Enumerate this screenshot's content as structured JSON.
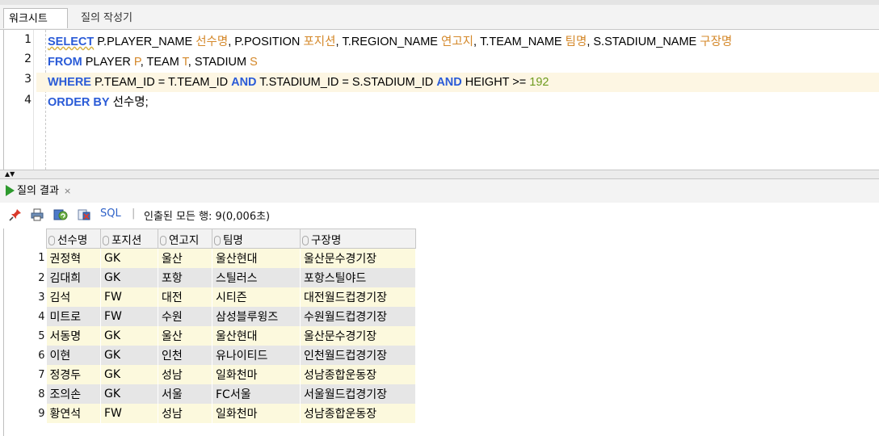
{
  "tabs": {
    "worksheet": "워크시트",
    "builder": "질의 작성기"
  },
  "sql": {
    "line_numbers": [
      "1",
      "2",
      "3",
      "4"
    ],
    "l1": {
      "select": "SELECT",
      "a": " P.PLAYER_NAME ",
      "a_alias": "선수명",
      "b": ", P.POSITION ",
      "b_alias": "포지션",
      "c": ", T.REGION_NAME ",
      "c_alias": "연고지",
      "d": ", T.TEAM_NAME ",
      "d_alias": "팀명",
      "e": ", S.STADIUM_NAME ",
      "e_alias": "구장명"
    },
    "l2": {
      "from": "FROM",
      "a": " PLAYER ",
      "a_alias": "P",
      "b": ", TEAM ",
      "b_alias": "T",
      "c": ", STADIUM ",
      "c_alias": "S"
    },
    "l3": {
      "where": "WHERE",
      "a": " P.TEAM_ID = T.TEAM_ID ",
      "and1": "AND",
      "b": " T.STADIUM_ID = S.STADIUM_ID ",
      "and2": "AND",
      "c": " HEIGHT >= ",
      "num": "192"
    },
    "l4": {
      "order": "ORDER BY",
      "rest": " 선수명;"
    }
  },
  "result_tab": {
    "label": "질의 결과",
    "close": "×"
  },
  "toolbar": {
    "sql_link": "SQL",
    "separator": "|",
    "fetch_status": "인출된 모든 행: 9(0,006초)"
  },
  "icons": {
    "pin": "pin-icon",
    "print": "print-icon",
    "refresh": "refresh-icon",
    "export": "export-icon"
  },
  "grid": {
    "columns": [
      "선수명",
      "포지션",
      "연고지",
      "팀명",
      "구장명"
    ],
    "rows": [
      {
        "n": "1",
        "cells": [
          "권정혁",
          "GK",
          "울산",
          "울산현대",
          "울산문수경기장"
        ]
      },
      {
        "n": "2",
        "cells": [
          "김대희",
          "GK",
          "포항",
          "스틸러스",
          "포항스틸야드"
        ]
      },
      {
        "n": "3",
        "cells": [
          "김석",
          "FW",
          "대전",
          "시티즌",
          "대전월드컵경기장"
        ]
      },
      {
        "n": "4",
        "cells": [
          "미트로",
          "FW",
          "수원",
          "삼성블루윙즈",
          "수원월드컵경기장"
        ]
      },
      {
        "n": "5",
        "cells": [
          "서동명",
          "GK",
          "울산",
          "울산현대",
          "울산문수경기장"
        ]
      },
      {
        "n": "6",
        "cells": [
          "이현",
          "GK",
          "인천",
          "유나이티드",
          "인천월드컵경기장"
        ]
      },
      {
        "n": "7",
        "cells": [
          "정경두",
          "GK",
          "성남",
          "일화천마",
          "성남종합운동장"
        ]
      },
      {
        "n": "8",
        "cells": [
          "조의손",
          "GK",
          "서울",
          "FC서울",
          "서울월드컵경기장"
        ]
      },
      {
        "n": "9",
        "cells": [
          "황연석",
          "FW",
          "성남",
          "일화천마",
          "성남종합운동장"
        ]
      }
    ]
  },
  "colors": {
    "keyword": "#2a5bd7",
    "alias": "#d4882a",
    "number": "#6d9b1e",
    "row_odd": "#fcf9dd",
    "row_even": "#e6e6e6"
  }
}
